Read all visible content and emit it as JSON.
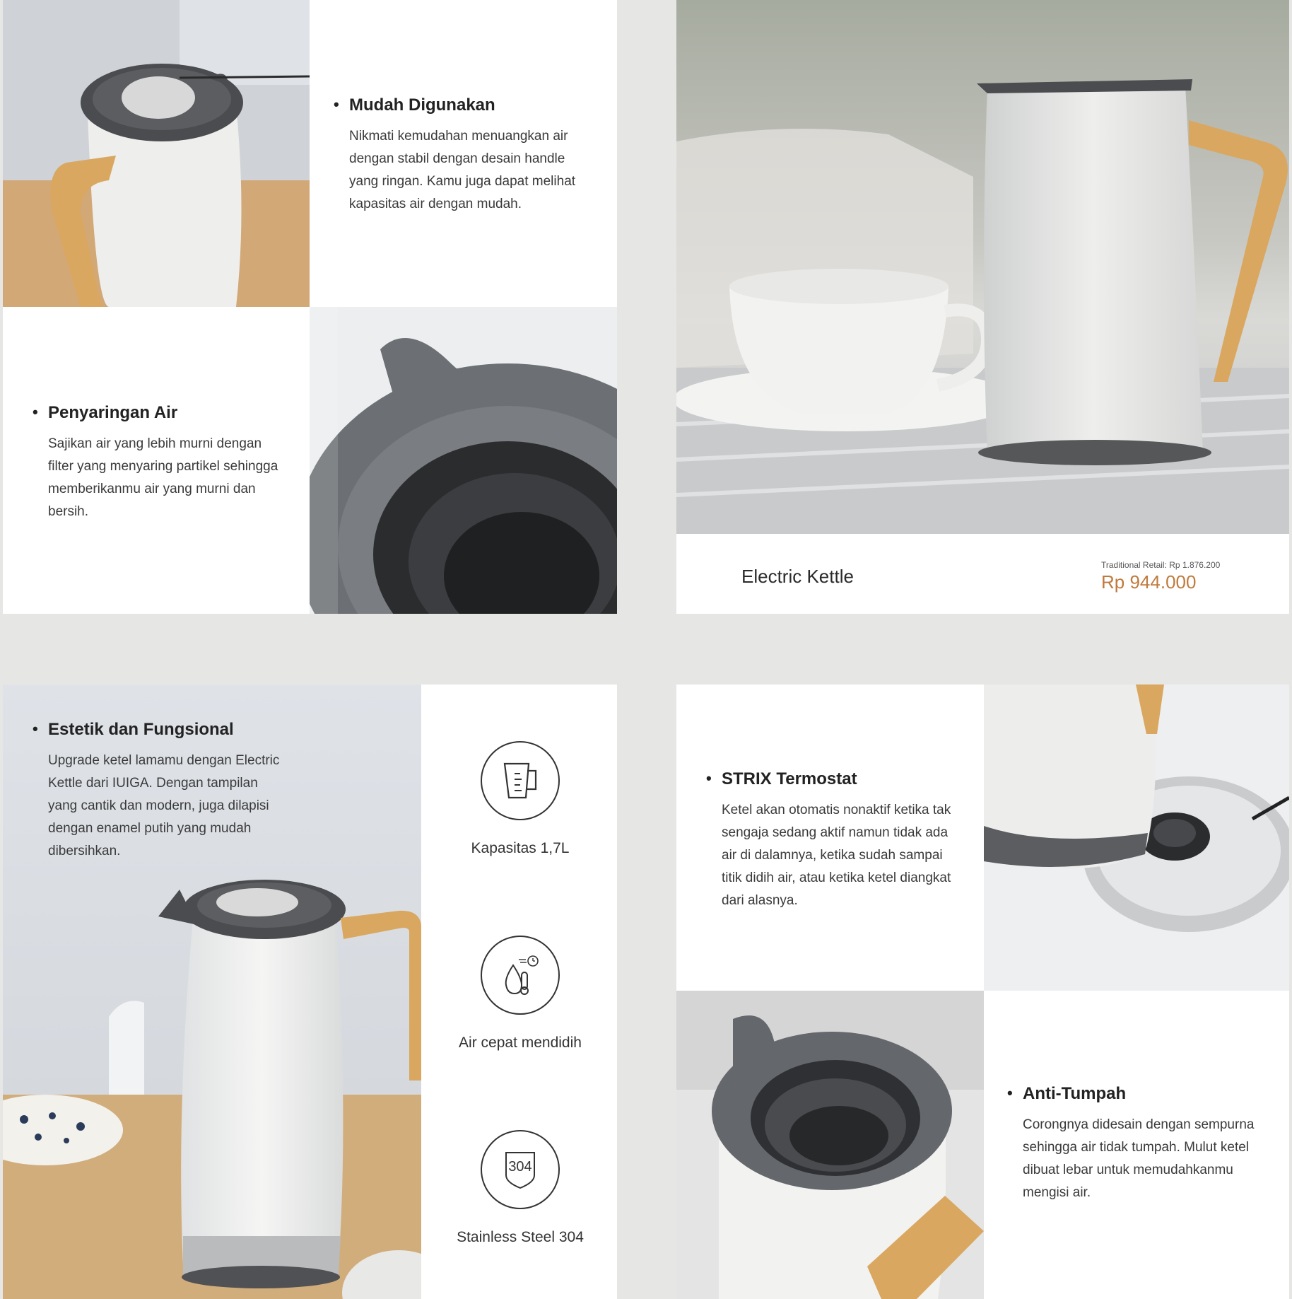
{
  "colors": {
    "background": "#e6e6e5",
    "panel": "#ffffff",
    "price": "#c07a3c",
    "wood": "#d9a75f",
    "lid_gray": "#5a5c5f"
  },
  "features": {
    "ease": {
      "title": "Mudah Digunakan",
      "body": "Nikmati kemudahan menuangkan air dengan stabil dengan desain handle yang ringan. Kamu juga dapat melihat kapasitas air dengan mudah."
    },
    "filter": {
      "title": "Penyaringan Air",
      "body": "Sajikan air yang lebih murni dengan filter yang menyaring partikel sehingga memberikanmu air yang murni dan bersih."
    },
    "aesthetic": {
      "title": "Estetik dan Fungsional",
      "body": "Upgrade ketel lamamu dengan Electric Kettle dari IUIGA. Dengan tampilan yang cantik dan modern, juga dilapisi dengan enamel putih yang mudah dibersihkan."
    },
    "thermostat": {
      "title": "STRIX Termostat",
      "body": "Ketel akan otomatis nonaktif ketika tak sengaja sedang aktif namun tidak ada air di dalamnya, ketika sudah sampai titik didih air, atau ketika ketel diangkat dari alasnya."
    },
    "spill": {
      "title": "Anti-Tumpah",
      "body": "Corongnya didesain dengan sempurna sehingga air tidak tumpah. Mulut ketel dibuat lebar untuk memudahkanmu mengisi air."
    }
  },
  "product": {
    "name": "Electric Kettle",
    "retail_label": "Traditional Retail: Rp 1.876.200",
    "price": "Rp 944.000"
  },
  "specs": [
    {
      "icon": "measuring-jug-icon",
      "label": "Kapasitas 1,7L"
    },
    {
      "icon": "fast-boil-icon",
      "label": "Air cepat mendidih"
    },
    {
      "icon": "shield-304-icon",
      "label": "Stainless Steel 304",
      "badge": "304"
    }
  ]
}
